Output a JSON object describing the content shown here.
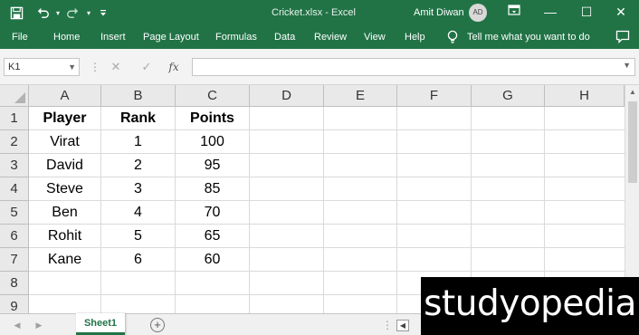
{
  "titlebar": {
    "filename": "Cricket.xlsx  -  Excel",
    "user_name": "Amit Diwan",
    "avatar_initials": "AD",
    "accent_color": "#217346"
  },
  "quick_access": [
    "save-icon",
    "undo-icon",
    "redo-icon",
    "customize-icon"
  ],
  "window_controls": {
    "ribbon_display": "▭",
    "minimize": "—",
    "maximize": "☐",
    "close": "✕"
  },
  "ribbon": {
    "tabs": [
      "File",
      "Home",
      "Insert",
      "Page Layout",
      "Formulas",
      "Data",
      "Review",
      "View",
      "Help"
    ],
    "tell_me": "Tell me what you want to do"
  },
  "formula_bar": {
    "name_box": "K1",
    "cancel_glyph": "✕",
    "enter_glyph": "✓",
    "fx_label": "fx",
    "formula_value": ""
  },
  "grid": {
    "columns": [
      "A",
      "B",
      "C",
      "D",
      "E",
      "F",
      "G",
      "H"
    ],
    "rows": [
      "1",
      "2",
      "3",
      "4",
      "5",
      "6",
      "7",
      "8",
      "9"
    ],
    "table": {
      "headers": [
        "Player",
        "Rank",
        "Points"
      ],
      "rows": [
        [
          "Virat",
          "1",
          "100"
        ],
        [
          "David",
          "2",
          "95"
        ],
        [
          "Steve",
          "3",
          "85"
        ],
        [
          "Ben",
          "4",
          "70"
        ],
        [
          "Rohit",
          "5",
          "65"
        ],
        [
          "Kane",
          "6",
          "60"
        ]
      ]
    }
  },
  "sheets": {
    "tabs": [
      "Sheet1"
    ],
    "active": "Sheet1",
    "add_glyph": "+"
  },
  "watermark": "studyopedia"
}
